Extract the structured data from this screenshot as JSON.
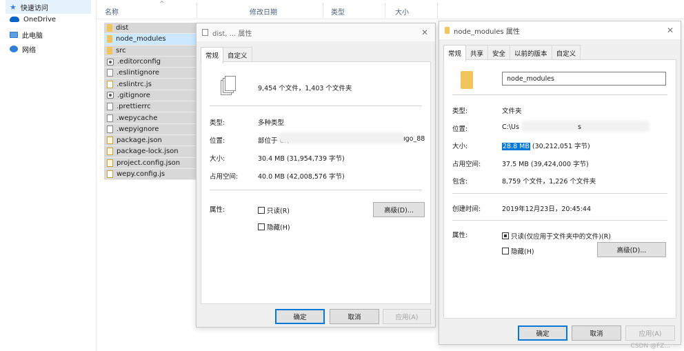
{
  "nav": {
    "items": [
      {
        "label": "快速访问",
        "icon": "star-icon"
      },
      {
        "label": "OneDrive",
        "icon": "cloud-icon"
      },
      {
        "label": "此电脑",
        "icon": "computer-icon"
      },
      {
        "label": "网络",
        "icon": "network-icon"
      }
    ]
  },
  "header": {
    "col_name": "名称",
    "col_modified": "修改日期",
    "col_type": "类型",
    "col_size": "大小"
  },
  "files": [
    {
      "name": "dist",
      "icon": "folder-icon"
    },
    {
      "name": "node_modules",
      "icon": "folder-icon"
    },
    {
      "name": "src",
      "icon": "folder-icon"
    },
    {
      "name": ".editorconfig",
      "icon": "config-file-icon"
    },
    {
      "name": ".eslintignore",
      "icon": "file-icon"
    },
    {
      "name": ".eslintrc.js",
      "icon": "js-file-icon"
    },
    {
      "name": ".gitignore",
      "icon": "config-file-icon"
    },
    {
      "name": ".prettierrc",
      "icon": "file-icon"
    },
    {
      "name": ".wepycache",
      "icon": "file-icon"
    },
    {
      "name": ".wepyignore",
      "icon": "file-icon"
    },
    {
      "name": "package.json",
      "icon": "json-file-icon"
    },
    {
      "name": "package-lock.json",
      "icon": "json-file-icon"
    },
    {
      "name": "project.config.json",
      "icon": "json-file-icon"
    },
    {
      "name": "wepy.config.js",
      "icon": "js-file-icon"
    }
  ],
  "dialog1": {
    "title": "dist, ... 属性",
    "tabs": [
      "常规",
      "自定义"
    ],
    "summary": "9,454 个文件，1,403 个文件夹",
    "type_label": "类型:",
    "type_value": "多种类型",
    "location_label": "位置:",
    "location_value": "部位于 C:\\",
    "location_tail": "ıgo_88",
    "size_label": "大小:",
    "size_value": "30.4 MB (31,954,739 字节)",
    "disk_label": "占用空间:",
    "disk_value": "40.0 MB (42,008,576 字节)",
    "attr_label": "属性:",
    "readonly": "只读(R)",
    "hidden": "隐藏(H)",
    "advanced": "高级(D)...",
    "ok": "确定",
    "cancel": "取消",
    "apply": "应用(A)"
  },
  "dialog2": {
    "title": "node_modules 属性",
    "tabs": [
      "常规",
      "共享",
      "安全",
      "以前的版本",
      "自定义"
    ],
    "name_value": "node_modules",
    "type_label": "类型:",
    "type_value": "文件夹",
    "location_label": "位置:",
    "location_value": "C:\\Us",
    "location_tail": "s",
    "size_label": "大小:",
    "size_highlight": "28.8 MB",
    "size_rest": " (30,212,051 字节)",
    "disk_label": "占用空间:",
    "disk_value": "37.5 MB (39,424,000 字节)",
    "contains_label": "包含:",
    "contains_value": "8,759 个文件，1,226 个文件夹",
    "created_label": "创建时间:",
    "created_value": "2019年12月23日，20:45:44",
    "attr_label": "属性:",
    "readonly": "只读(仅应用于文件夹中的文件)(R)",
    "hidden": "隐藏(H)",
    "advanced": "高级(D)...",
    "ok": "确定",
    "cancel": "取消",
    "apply": "应用(A)"
  },
  "watermark": "CSDN @FZ..."
}
